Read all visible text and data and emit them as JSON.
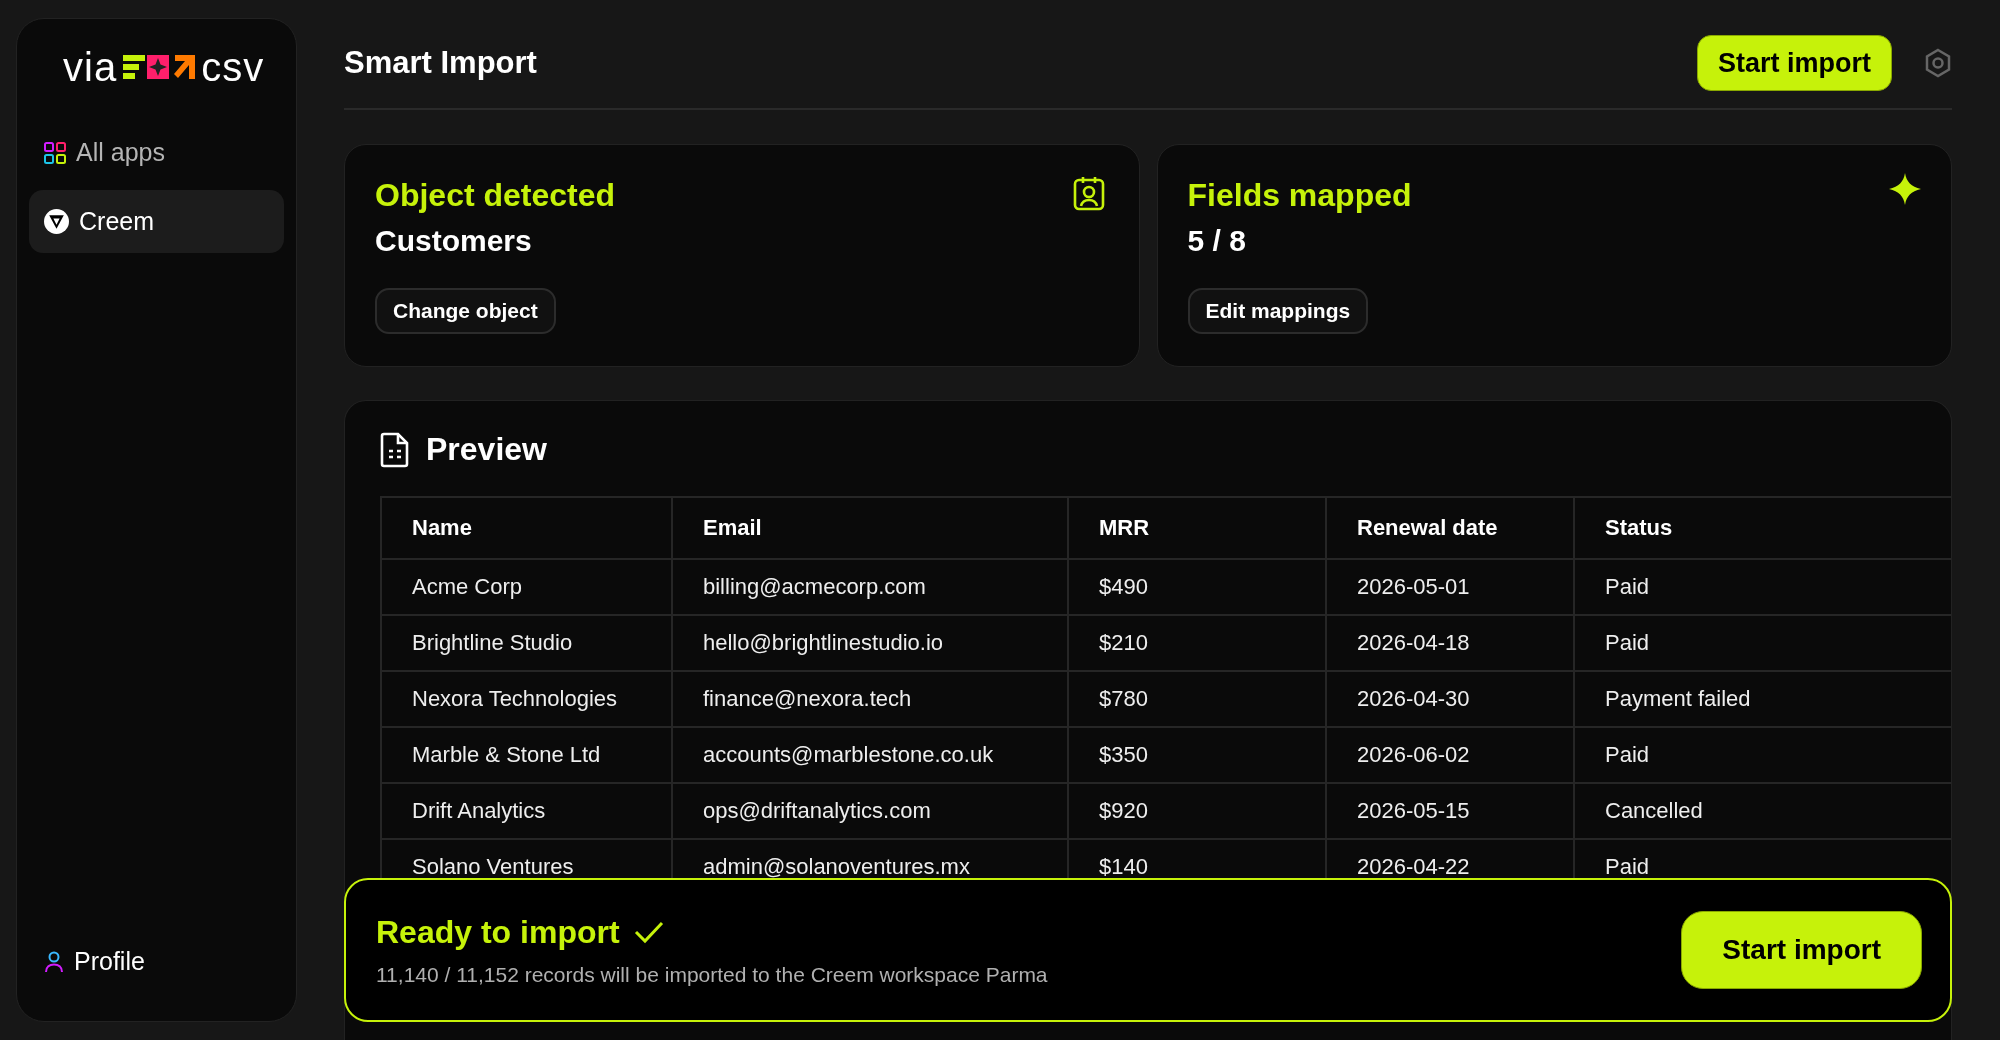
{
  "sidebar": {
    "logo": {
      "left": "via",
      "right": "csv"
    },
    "items": [
      {
        "label": "All apps",
        "selected": false
      },
      {
        "label": "Creem",
        "selected": true
      }
    ],
    "footer": {
      "label": "Profile"
    }
  },
  "header": {
    "title": "Smart Import",
    "button": "Start import"
  },
  "cards": [
    {
      "title": "Object detected",
      "value": "Customers",
      "button": "Change object"
    },
    {
      "title": "Fields mapped",
      "value": "5 / 8",
      "button": "Edit mappings"
    }
  ],
  "preview": {
    "title": "Preview",
    "columns": [
      "Name",
      "Email",
      "MRR",
      "Renewal date",
      "Status"
    ],
    "rows": [
      [
        "Acme Corp",
        "billing@acmecorp.com",
        "$490",
        "2026-05-01",
        "Paid"
      ],
      [
        "Brightline Studio",
        "hello@brightlinestudio.io",
        "$210",
        "2026-04-18",
        "Paid"
      ],
      [
        "Nexora Technologies",
        "finance@nexora.tech",
        "$780",
        "2026-04-30",
        "Payment failed"
      ],
      [
        "Marble & Stone Ltd",
        "accounts@marblestone.co.uk",
        "$350",
        "2026-06-02",
        "Paid"
      ],
      [
        "Drift Analytics",
        "ops@driftanalytics.com",
        "$920",
        "2026-05-15",
        "Cancelled"
      ],
      [
        "Solano Ventures",
        "admin@solanoventures.mx",
        "$140",
        "2026-04-22",
        "Paid"
      ]
    ]
  },
  "banner": {
    "title": "Ready to import",
    "message": "11,140 / 11,152 records will be imported to the Creem workspace Parma",
    "button": "Start import"
  }
}
